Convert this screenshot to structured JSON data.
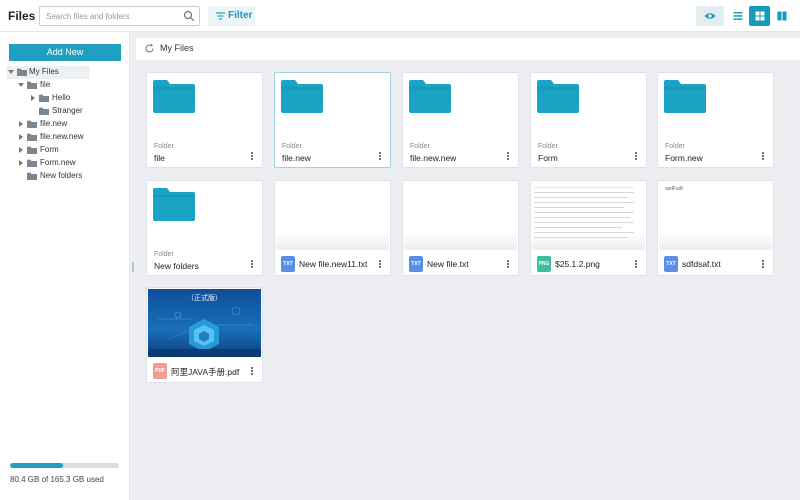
{
  "header": {
    "app_title": "Files",
    "search_placeholder": "Search files and folders",
    "filter_label": "Filter",
    "accent_color": "#1a9bbd",
    "view_buttons": [
      {
        "icon": "eye-icon"
      },
      {
        "icon": "list-view-icon"
      },
      {
        "icon": "grid-view-icon"
      },
      {
        "icon": "split-view-icon"
      }
    ]
  },
  "sidebar": {
    "add_label": "Add New",
    "tree": [
      {
        "label": "My Files",
        "expanded": true
      },
      {
        "label": "file",
        "expanded": true
      },
      {
        "label": "Hello",
        "expanded": false
      },
      {
        "label": "Stranger",
        "expanded": false
      },
      {
        "label": "file.new",
        "expanded": false
      },
      {
        "label": "file.new.new",
        "expanded": false
      },
      {
        "label": "Form",
        "expanded": false
      },
      {
        "label": "Form.new",
        "expanded": false
      },
      {
        "label": "New folders",
        "expanded": false
      }
    ],
    "storage": {
      "used_fraction": 0.486,
      "text": "80.4 GB of 165.3 GB used"
    }
  },
  "main": {
    "breadcrumb": "My Files",
    "folder_kind_label": "Folder",
    "folders": [
      {
        "name": "file"
      },
      {
        "name": "file.new"
      },
      {
        "name": "file.new.new"
      },
      {
        "name": "Form"
      },
      {
        "name": "Form.new"
      },
      {
        "name": "New folders"
      }
    ],
    "files": [
      {
        "name": "New file.new11.txt",
        "type": "TXT"
      },
      {
        "name": "New file.txt",
        "type": "TXT"
      },
      {
        "name": "$25.1.2.png",
        "type": "PNG"
      },
      {
        "name": "sdfdsaf.txt",
        "type": "TXT",
        "preview_text": "asdFsdf"
      },
      {
        "name": "阿里JAVA手册.pdf",
        "type": "PDF",
        "preview_text": "（正式版）"
      }
    ]
  }
}
